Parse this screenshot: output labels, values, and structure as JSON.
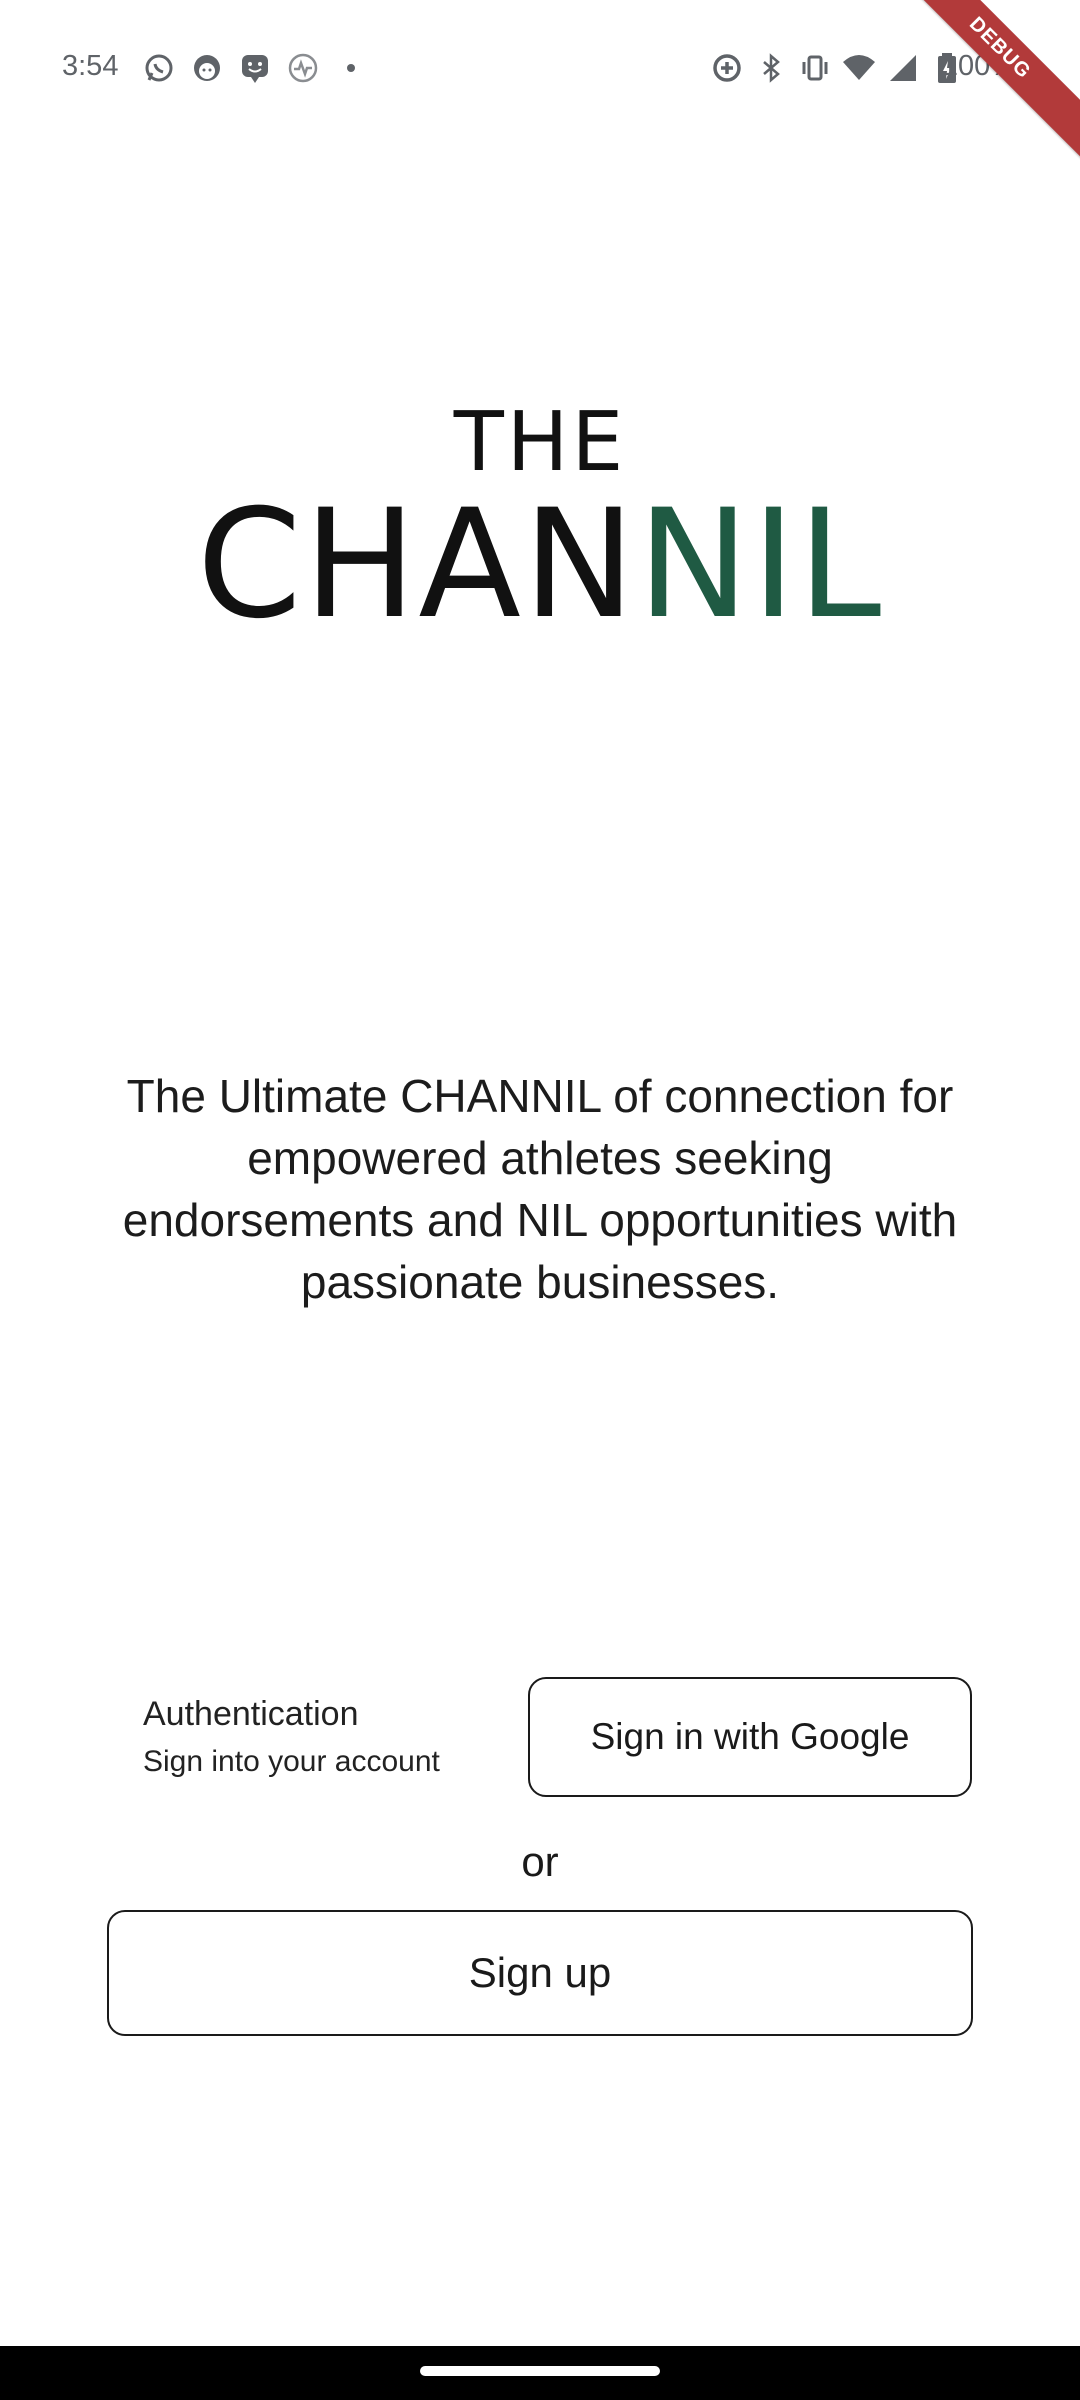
{
  "status_bar": {
    "time": "3:54",
    "battery_percent": "100%",
    "left_icons": [
      "whatsapp-icon",
      "face-app-icon",
      "chat-app-icon",
      "health-icon",
      "dot-icon"
    ],
    "right_icons": [
      "data-saver-icon",
      "bluetooth-icon",
      "vibrate-icon",
      "wifi-icon",
      "signal-icon",
      "battery-icon"
    ]
  },
  "debug_banner": "DEBUG",
  "logo": {
    "line1": "THE",
    "word_dark": "CHAN",
    "word_green": "NIL",
    "green_color": "#1f5a43"
  },
  "tagline": "The Ultimate CHANNIL of connection for empowered athletes seeking endorsements and NIL opportunities with passionate businesses.",
  "auth": {
    "title": "Authentication",
    "subtitle": "Sign into your account",
    "google_button": "Sign in with Google",
    "or": "or",
    "signup_button": "Sign up"
  }
}
